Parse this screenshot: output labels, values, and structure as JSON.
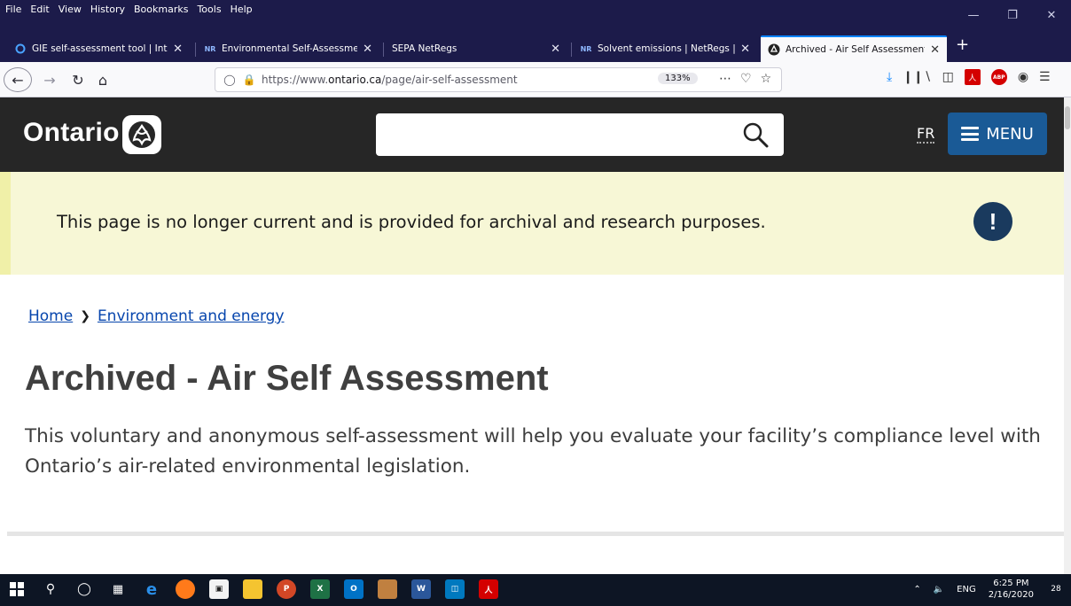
{
  "browser": {
    "menus": [
      "File",
      "Edit",
      "View",
      "History",
      "Bookmarks",
      "Tools",
      "Help"
    ],
    "tabs": [
      {
        "title": "GIE self-assessment tool | Inter",
        "active": false
      },
      {
        "title": "Environmental Self-Assessment",
        "active": false
      },
      {
        "title": "SEPA NetRegs",
        "active": false
      },
      {
        "title": "Solvent emissions | NetRegs | E",
        "active": false
      },
      {
        "title": "Archived - Air Self Assessment",
        "active": true
      }
    ],
    "favicon_nr": "NR",
    "url_prefix": "https://www.",
    "url_domain": "ontario.ca",
    "url_path": "/page/air-self-assessment",
    "zoom": "133%",
    "pdf_label": "人",
    "abp_label": "ABP"
  },
  "site": {
    "logo_text": "Ontario",
    "search_placeholder": "",
    "lang_link": "FR",
    "menu_label": "MENU"
  },
  "alert": {
    "text": "This page is no longer current and is provided for archival and research purposes.",
    "icon_glyph": "!"
  },
  "breadcrumb": {
    "home": "Home",
    "section": "Environment and energy"
  },
  "page": {
    "title": "Archived - Air Self Assessment",
    "lead": "This voluntary and anonymous self-assessment will help you evaluate your facility’s compliance level with Ontario’s air-related environmental legislation."
  },
  "taskbar": {
    "lang": "ENG",
    "time": "6:25 PM",
    "date": "2/16/2020",
    "notif_count": "28"
  },
  "colors": {
    "header_bg": "#262626",
    "menu_button": "#1a5a96",
    "alert_bg": "#f7f7d6",
    "alert_icon": "#1a3a5e",
    "link": "#0645ad",
    "browser_frame": "#1c1b4a"
  }
}
